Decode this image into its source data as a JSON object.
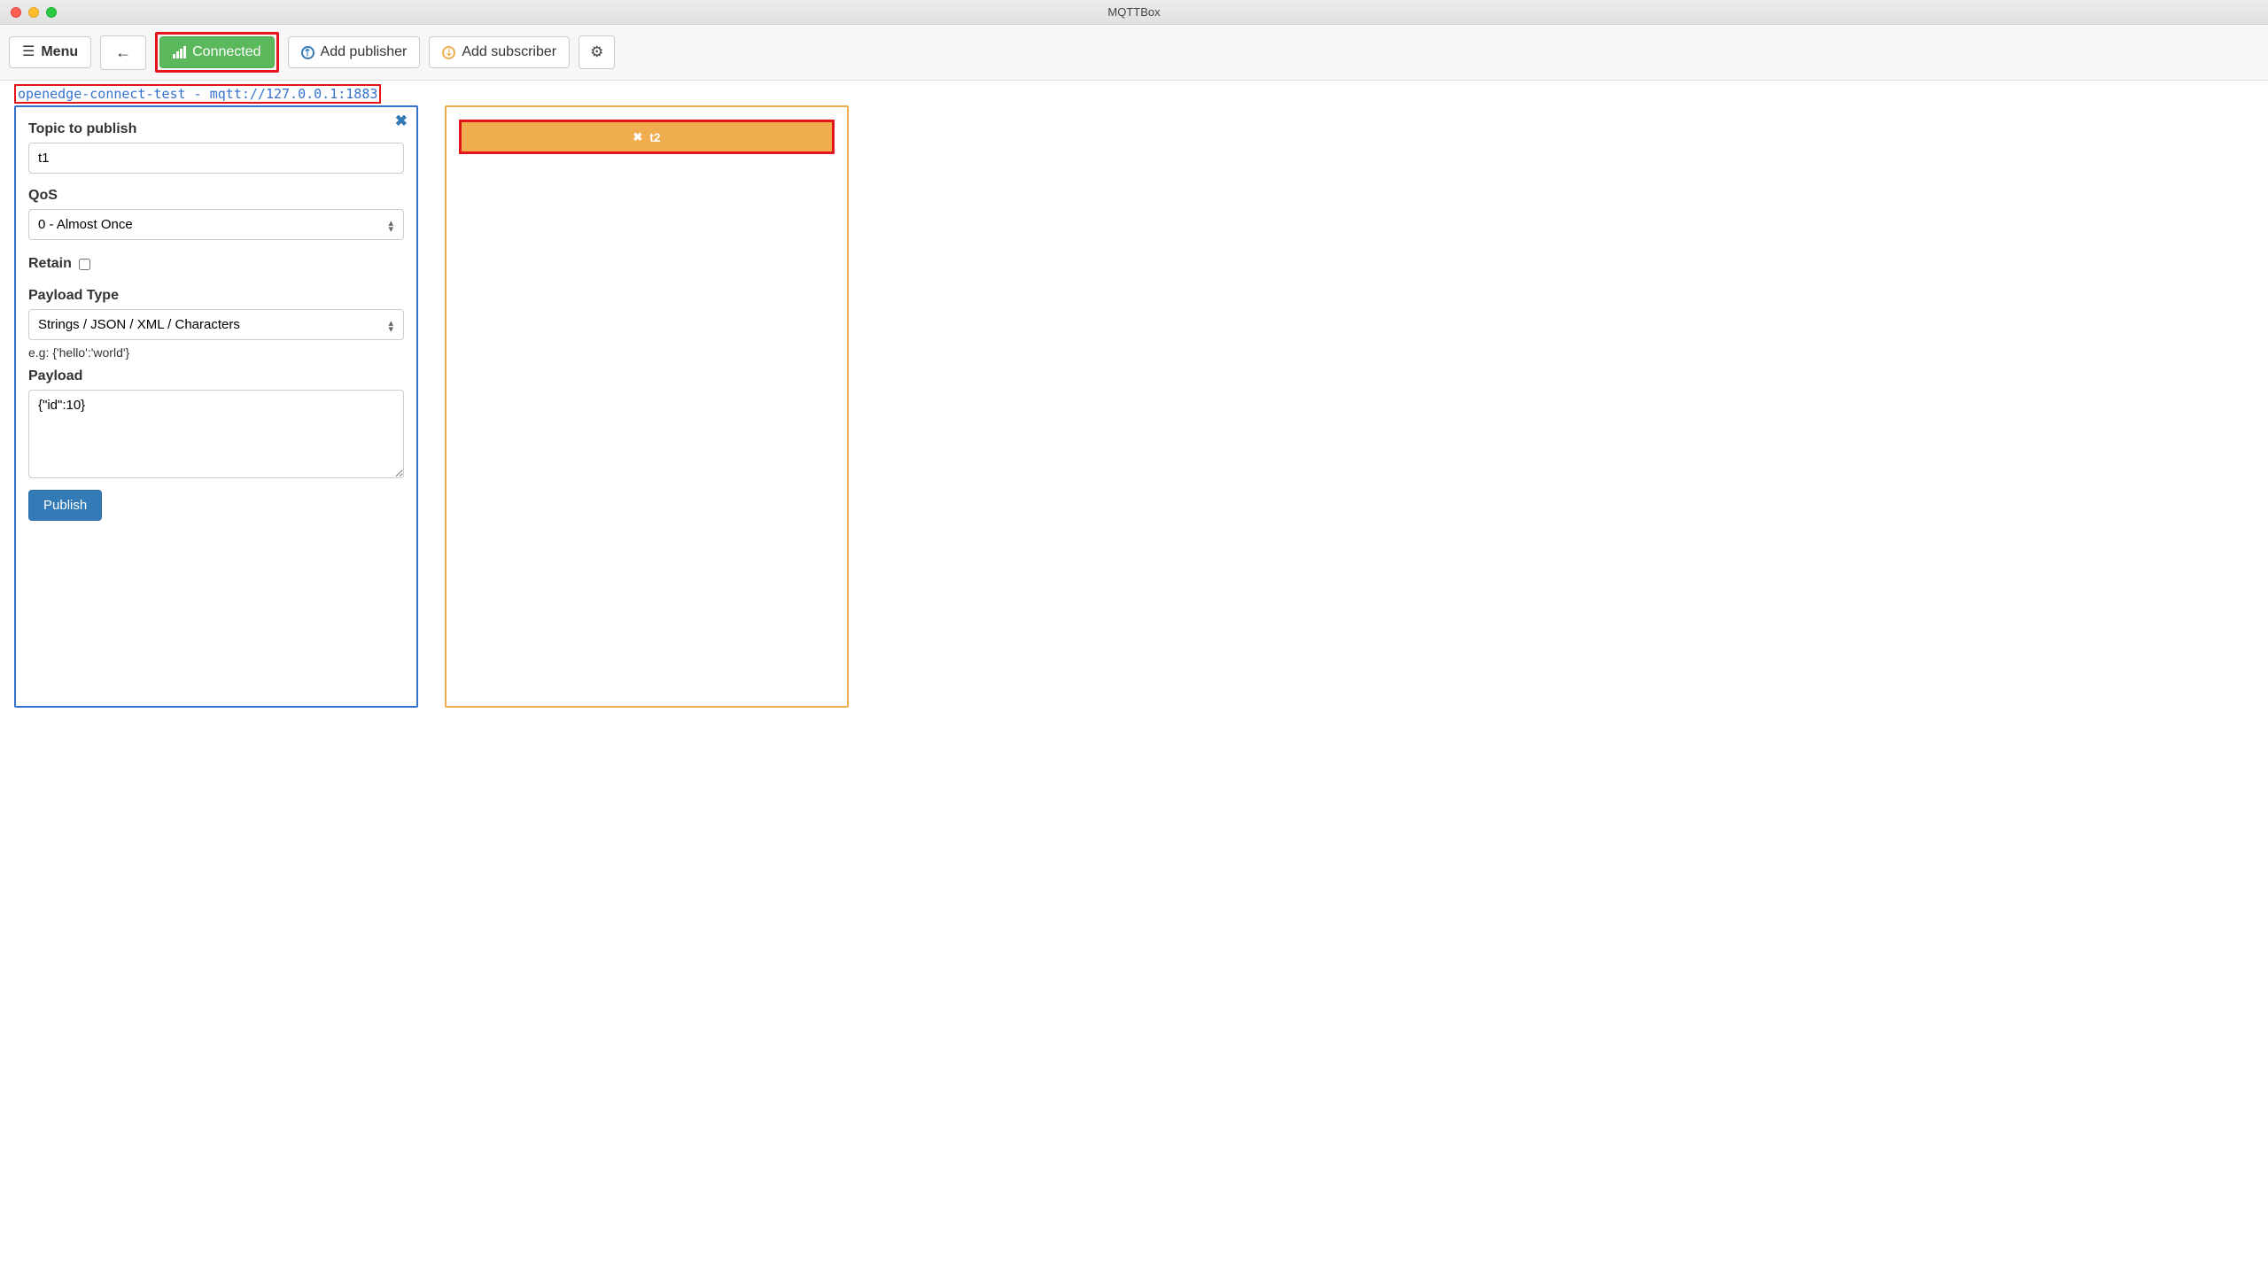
{
  "window": {
    "title": "MQTTBox"
  },
  "toolbar": {
    "menu_label": "Menu",
    "connected_label": "Connected",
    "add_publisher_label": "Add publisher",
    "add_subscriber_label": "Add subscriber"
  },
  "connection_string": "openedge-connect-test - mqtt://127.0.0.1:1883",
  "publisher": {
    "topic_label": "Topic to publish",
    "topic_value": "t1",
    "qos_label": "QoS",
    "qos_value": "0 - Almost Once",
    "retain_label": "Retain",
    "retain_checked": false,
    "payload_type_label": "Payload Type",
    "payload_type_value": "Strings / JSON / XML / Characters",
    "payload_type_help": "e.g: {'hello':'world'}",
    "payload_label": "Payload",
    "payload_value": "{\"id\":10}",
    "publish_btn": "Publish"
  },
  "subscriber": {
    "topic": "t2"
  }
}
